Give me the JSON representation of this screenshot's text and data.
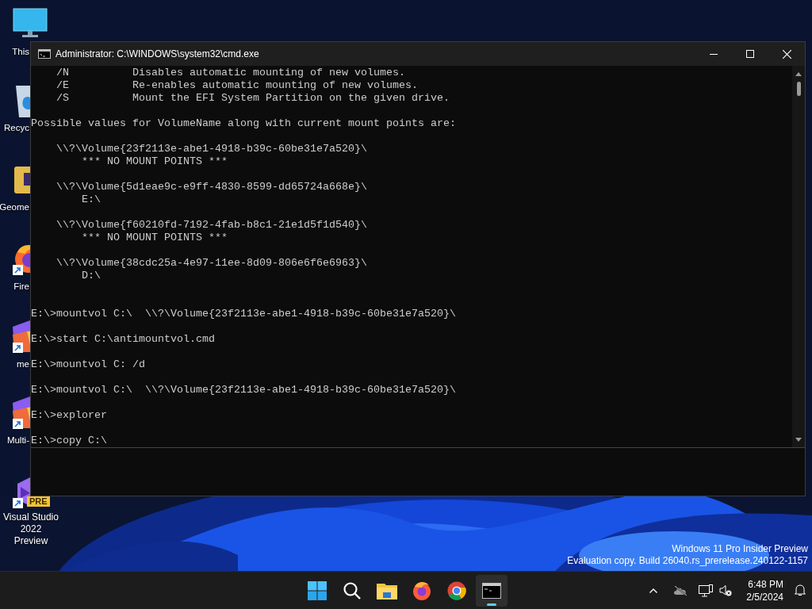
{
  "desktop_icons": [
    {
      "kind": "monitor",
      "label": "This"
    },
    {
      "kind": "recycle-bin",
      "label": "Recyc"
    },
    {
      "kind": "folder-app",
      "label": "Geome"
    },
    {
      "kind": "firefox",
      "label": "Fire",
      "shortcut": true
    },
    {
      "kind": "vs-app",
      "label": "me",
      "shortcut": true
    },
    {
      "kind": "vs-app",
      "label": "Multi-",
      "shortcut": true
    },
    {
      "kind": "vs-preview",
      "label": "Visual Studio 2022 Preview",
      "shortcut": true,
      "badge": "PRE"
    }
  ],
  "window": {
    "title": "Administrator: C:\\WINDOWS\\system32\\cmd.exe",
    "console": [
      {
        "kind": "output",
        "lines": [
          "    /N          Disables automatic mounting of new volumes.",
          "    /E          Re-enables automatic mounting of new volumes.",
          "    /S          Mount the EFI System Partition on the given drive."
        ]
      },
      {
        "kind": "output",
        "lines": [
          "Possible values for VolumeName along with current mount points are:"
        ]
      },
      {
        "kind": "output",
        "lines": [
          "    \\\\?\\Volume{23f2113e-abe1-4918-b39c-60be31e7a520}\\",
          "        *** NO MOUNT POINTS ***"
        ]
      },
      {
        "kind": "output",
        "lines": [
          "    \\\\?\\Volume{5d1eae9c-e9ff-4830-8599-dd65724a668e}\\",
          "        E:\\"
        ]
      },
      {
        "kind": "output",
        "lines": [
          "    \\\\?\\Volume{f60210fd-7192-4fab-b8c1-21e1d5f1d540}\\",
          "        *** NO MOUNT POINTS ***"
        ]
      },
      {
        "kind": "output",
        "lines": [
          "    \\\\?\\Volume{38cdc25a-4e97-11ee-8d09-806e6f6e6963}\\",
          "        D:\\"
        ]
      },
      {
        "kind": "command",
        "lines": [
          "E:\\>mountvol C:\\  \\\\?\\Volume{23f2113e-abe1-4918-b39c-60be31e7a520}\\"
        ]
      },
      {
        "kind": "command",
        "lines": [
          "E:\\>start C:\\antimountvol.cmd"
        ]
      },
      {
        "kind": "command",
        "lines": [
          "E:\\>mountvol C: /d"
        ]
      },
      {
        "kind": "command",
        "lines": [
          "E:\\>mountvol C:\\  \\\\?\\Volume{23f2113e-abe1-4918-b39c-60be31e7a520}\\"
        ]
      },
      {
        "kind": "command",
        "lines": [
          "E:\\>explorer"
        ]
      },
      {
        "kind": "command",
        "lines": [
          "E:\\>copy C:\\"
        ]
      }
    ]
  },
  "system_watermark": [
    "Windows 11 Pro Insider Preview",
    "Evaluation copy. Build 26040.rs_prerelease.240122-1157"
  ],
  "taskbar": {
    "apps": [
      {
        "kind": "start",
        "active": false
      },
      {
        "kind": "search",
        "active": false
      },
      {
        "kind": "file-explorer",
        "active": false
      },
      {
        "kind": "firefox",
        "active": false
      },
      {
        "kind": "chrome",
        "active": false
      },
      {
        "kind": "terminal",
        "active": true
      }
    ],
    "tray": {
      "time": "6:48 PM",
      "date": "2/5/2024"
    }
  }
}
